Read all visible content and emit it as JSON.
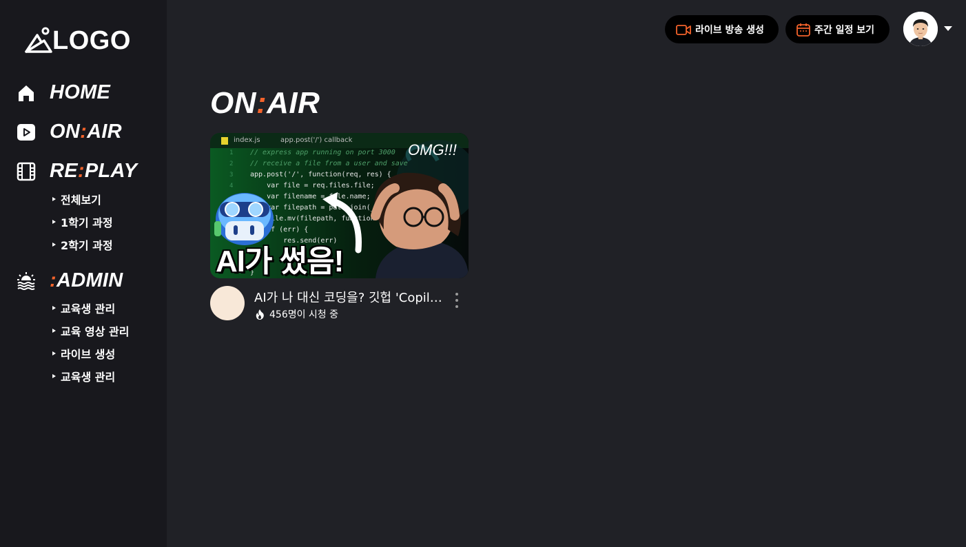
{
  "sidebar": {
    "logo_text": "LOGO",
    "nav": [
      {
        "label_a": "HOME",
        "label_colon": "",
        "label_b": "",
        "icon": "home-icon"
      },
      {
        "label_a": "ON",
        "label_colon": ":",
        "label_b": "AIR",
        "icon": "play-icon"
      },
      {
        "label_a": "RE",
        "label_colon": ":",
        "label_b": "PLAY",
        "icon": "film-icon"
      },
      {
        "label_a": "",
        "label_colon": ":",
        "label_b": "ADMIN",
        "icon": "sunset-icon"
      }
    ],
    "replay_sub": [
      "전체보기",
      "1학기 과정",
      "2학기 과정"
    ],
    "admin_sub": [
      "교육생 관리",
      "교육 영상 관리",
      "라이브 생성",
      "교육생 관리"
    ]
  },
  "header": {
    "live_button": "라이브 방송 생성",
    "schedule_button": "주간 일정 보기",
    "live_icon": "video-camera-icon",
    "schedule_icon": "calendar-icon"
  },
  "page": {
    "title_a": "ON",
    "title_colon": ":",
    "title_b": "AIR"
  },
  "video": {
    "thumb_caption": "AI가 썼음!",
    "thumb_omg": "OMG!!!",
    "thumb_tab": "index.js",
    "thumb_crumb": "app.post('/') callback",
    "title": "AI가 나 대신 코딩을? 깃헙 'Copilot' 사용기",
    "viewers": "456명이 시청 중",
    "code_lines": [
      "// express app running on port 3000",
      "// receive a file from a user and save",
      "app.post('/', function(req, res) {",
      "    var file = req.files.file;",
      "    var filename = file.name;",
      "    var filepath = path.join(__dirname",
      "    file.mv(filepath, function",
      "    if (err) {",
      "        res.send(err)",
      "    }",
      "}"
    ]
  },
  "colors": {
    "accent": "#f4632b",
    "sidebar_bg": "#18181d",
    "main_bg": "#202126"
  }
}
